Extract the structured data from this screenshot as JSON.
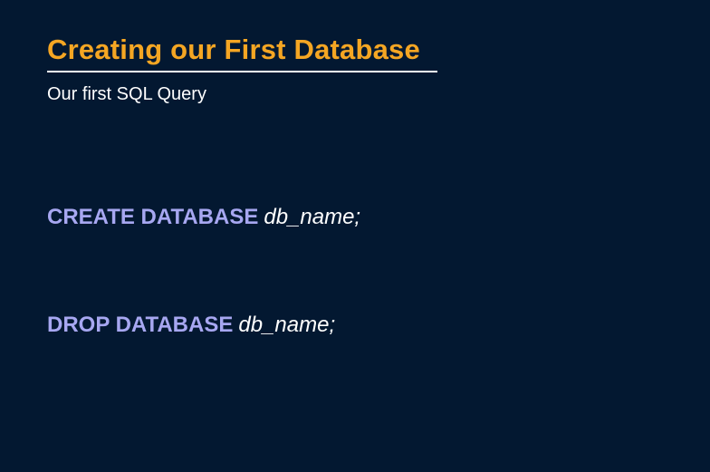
{
  "slide": {
    "title": "Creating our First Database",
    "subtitle": "Our first SQL Query",
    "queries": [
      {
        "keyword": "CREATE DATABASE",
        "identifier": "db_name;"
      },
      {
        "keyword": "DROP DATABASE",
        "identifier": "db_name;"
      }
    ]
  },
  "colors": {
    "background": "#031831",
    "title": "#F5A623",
    "keyword": "#A7A7F1",
    "text": "#FFFFFF"
  }
}
